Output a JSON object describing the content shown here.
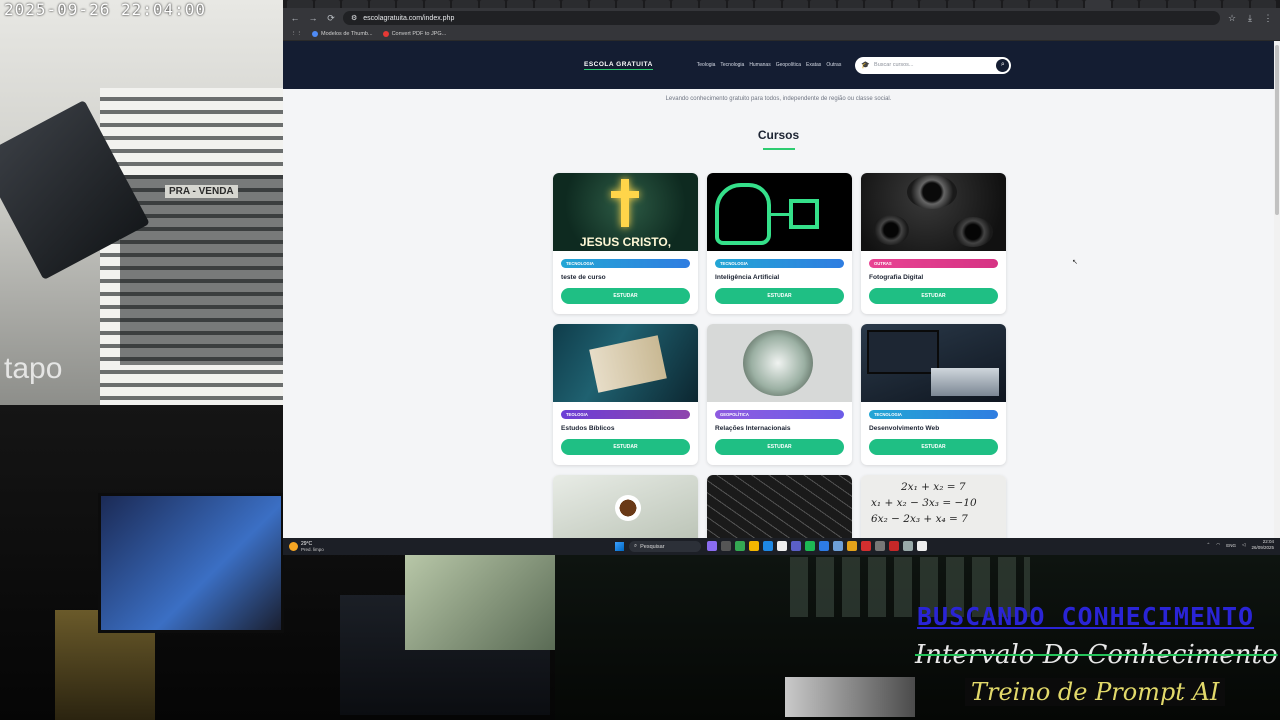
{
  "camera": {
    "timestamp": "2025-09-26  22:04:00",
    "brand": "tapo",
    "sign_text": "PRA - VENDA"
  },
  "overlay": {
    "line1": "BUSCANDO CONHECIMENTO",
    "line2": "Intervalo Do Conhecimento",
    "line3": "Treino de Prompt AI"
  },
  "browser": {
    "url": "escolagratuita.com/index.php",
    "bookmarks": [
      "Modelos de Thumb...",
      "Convert PDF to JPG..."
    ],
    "nav": {
      "back": "←",
      "forward": "→",
      "reload": "⟳"
    }
  },
  "site": {
    "logo": "ESCOLA GRATUITA",
    "nav_links": [
      "Teologia",
      "Tecnologia",
      "Humanas",
      "Geopolítica",
      "Exatas",
      "Outras"
    ],
    "search_placeholder": "Buscar cursos...",
    "tagline": "Levando conhecimento gratuito para todos, independente de região ou classe social.",
    "section_title": "Cursos",
    "cta_label": "ESTUDAR",
    "courses": [
      {
        "category": "TECNOLOGIA",
        "title": "teste de curso",
        "image_text": "JESUS CRISTO,"
      },
      {
        "category": "TECNOLOGIA",
        "title": "Inteligência Artificial"
      },
      {
        "category": "OUTRAS",
        "title": "Fotografia Digital"
      },
      {
        "category": "TEOLOGIA",
        "title": "Estudos Bíblicos"
      },
      {
        "category": "GEOPOLÍTICA",
        "title": "Relações Internacionais"
      },
      {
        "category": "TECNOLOGIA",
        "title": "Desenvolvimento Web"
      }
    ],
    "math_lines": [
      "2x₁ + x₂ = 7",
      "x₁ + x₂ − 3x₃ = −10",
      "6x₂ − 2x₃ + x₄ = 7"
    ]
  },
  "taskbar": {
    "temperature": "29°C",
    "weather": "Pred. limpo",
    "search": "Pesquisar",
    "lang": "ENG",
    "time": "22:04",
    "date": "26/09/2025"
  },
  "colors": {
    "header_bg": "#141d32",
    "accent_green": "#1fbf84",
    "badge_tecnologia": "#2f7de1",
    "badge_outras": "#e84393",
    "badge_teologia": "#6c3fd6",
    "badge_geopolitica": "#8e5be0"
  }
}
